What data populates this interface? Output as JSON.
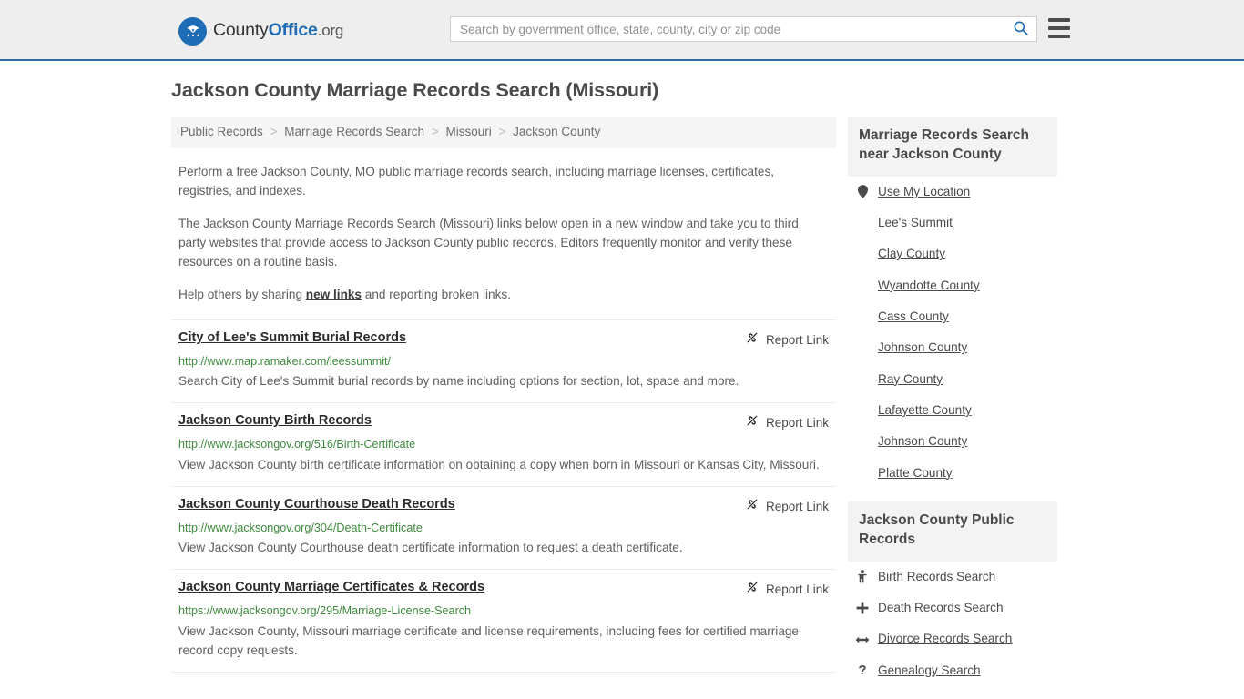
{
  "header": {
    "brand": {
      "part1": "County",
      "part2": "Office",
      "part3": ".org"
    },
    "search": {
      "placeholder": "Search by government office, state, county, city or zip code",
      "value": ""
    },
    "search_icon": "search-icon",
    "menu_icon": "hamburger-menu-icon",
    "accent_color": "#2d6ca2",
    "background_color": "#eeeeee"
  },
  "page": {
    "title": "Jackson County Marriage Records Search (Missouri)"
  },
  "breadcrumb": {
    "separator": ">",
    "items": [
      {
        "label": "Public Records"
      },
      {
        "label": "Marriage Records Search"
      },
      {
        "label": "Missouri"
      },
      {
        "label": "Jackson County"
      }
    ]
  },
  "intro": {
    "paragraph1": "Perform a free Jackson County, MO public marriage records search, including marriage licenses, certificates, registries, and indexes.",
    "paragraph2": "The Jackson County Marriage Records Search (Missouri) links below open in a new window and take you to third party websites that provide access to Jackson County public records. Editors frequently monitor and verify these resources on a routine basis.",
    "share_prefix": "Help others by sharing ",
    "share_link": "new links",
    "share_suffix": " and reporting broken links."
  },
  "results": {
    "report_label": "Report Link",
    "report_icon": "broken-link-icon",
    "items": [
      {
        "title": "City of Lee's Summit Burial Records",
        "url": "http://www.map.ramaker.com/leessummit/",
        "description": "Search City of Lee's Summit burial records by name including options for section, lot, space and more."
      },
      {
        "title": "Jackson County Birth Records",
        "url": "http://www.jacksongov.org/516/Birth-Certificate",
        "description": "View Jackson County birth certificate information on obtaining a copy when born in Missouri or Kansas City, Missouri."
      },
      {
        "title": "Jackson County Courthouse Death Records",
        "url": "http://www.jacksongov.org/304/Death-Certificate",
        "description": "View Jackson County Courthouse death certificate information to request a death certificate."
      },
      {
        "title": "Jackson County Marriage Certificates & Records",
        "url": "https://www.jacksongov.org/295/Marriage-License-Search",
        "description": "View Jackson County, Missouri marriage certificate and license requirements, including fees for certified marriage record copy requests."
      }
    ]
  },
  "sidebar": {
    "nearby": {
      "title": "Marriage Records Search near Jackson County",
      "use_my_location": {
        "label": "Use My Location",
        "icon": "map-pin-icon"
      },
      "links": [
        {
          "label": "Lee's Summit"
        },
        {
          "label": "Clay County"
        },
        {
          "label": "Wyandotte County"
        },
        {
          "label": "Cass County"
        },
        {
          "label": "Johnson County"
        },
        {
          "label": "Ray County"
        },
        {
          "label": "Lafayette County"
        },
        {
          "label": "Johnson County"
        },
        {
          "label": "Platte County"
        }
      ]
    },
    "public_records": {
      "title": "Jackson County Public Records",
      "links": [
        {
          "label": "Birth Records Search",
          "icon": "baby-icon"
        },
        {
          "label": "Death Records Search",
          "icon": "cross-icon"
        },
        {
          "label": "Divorce Records Search",
          "icon": "left-right-arrow-icon"
        },
        {
          "label": "Genealogy Search",
          "icon": "question-mark-icon"
        }
      ]
    }
  }
}
